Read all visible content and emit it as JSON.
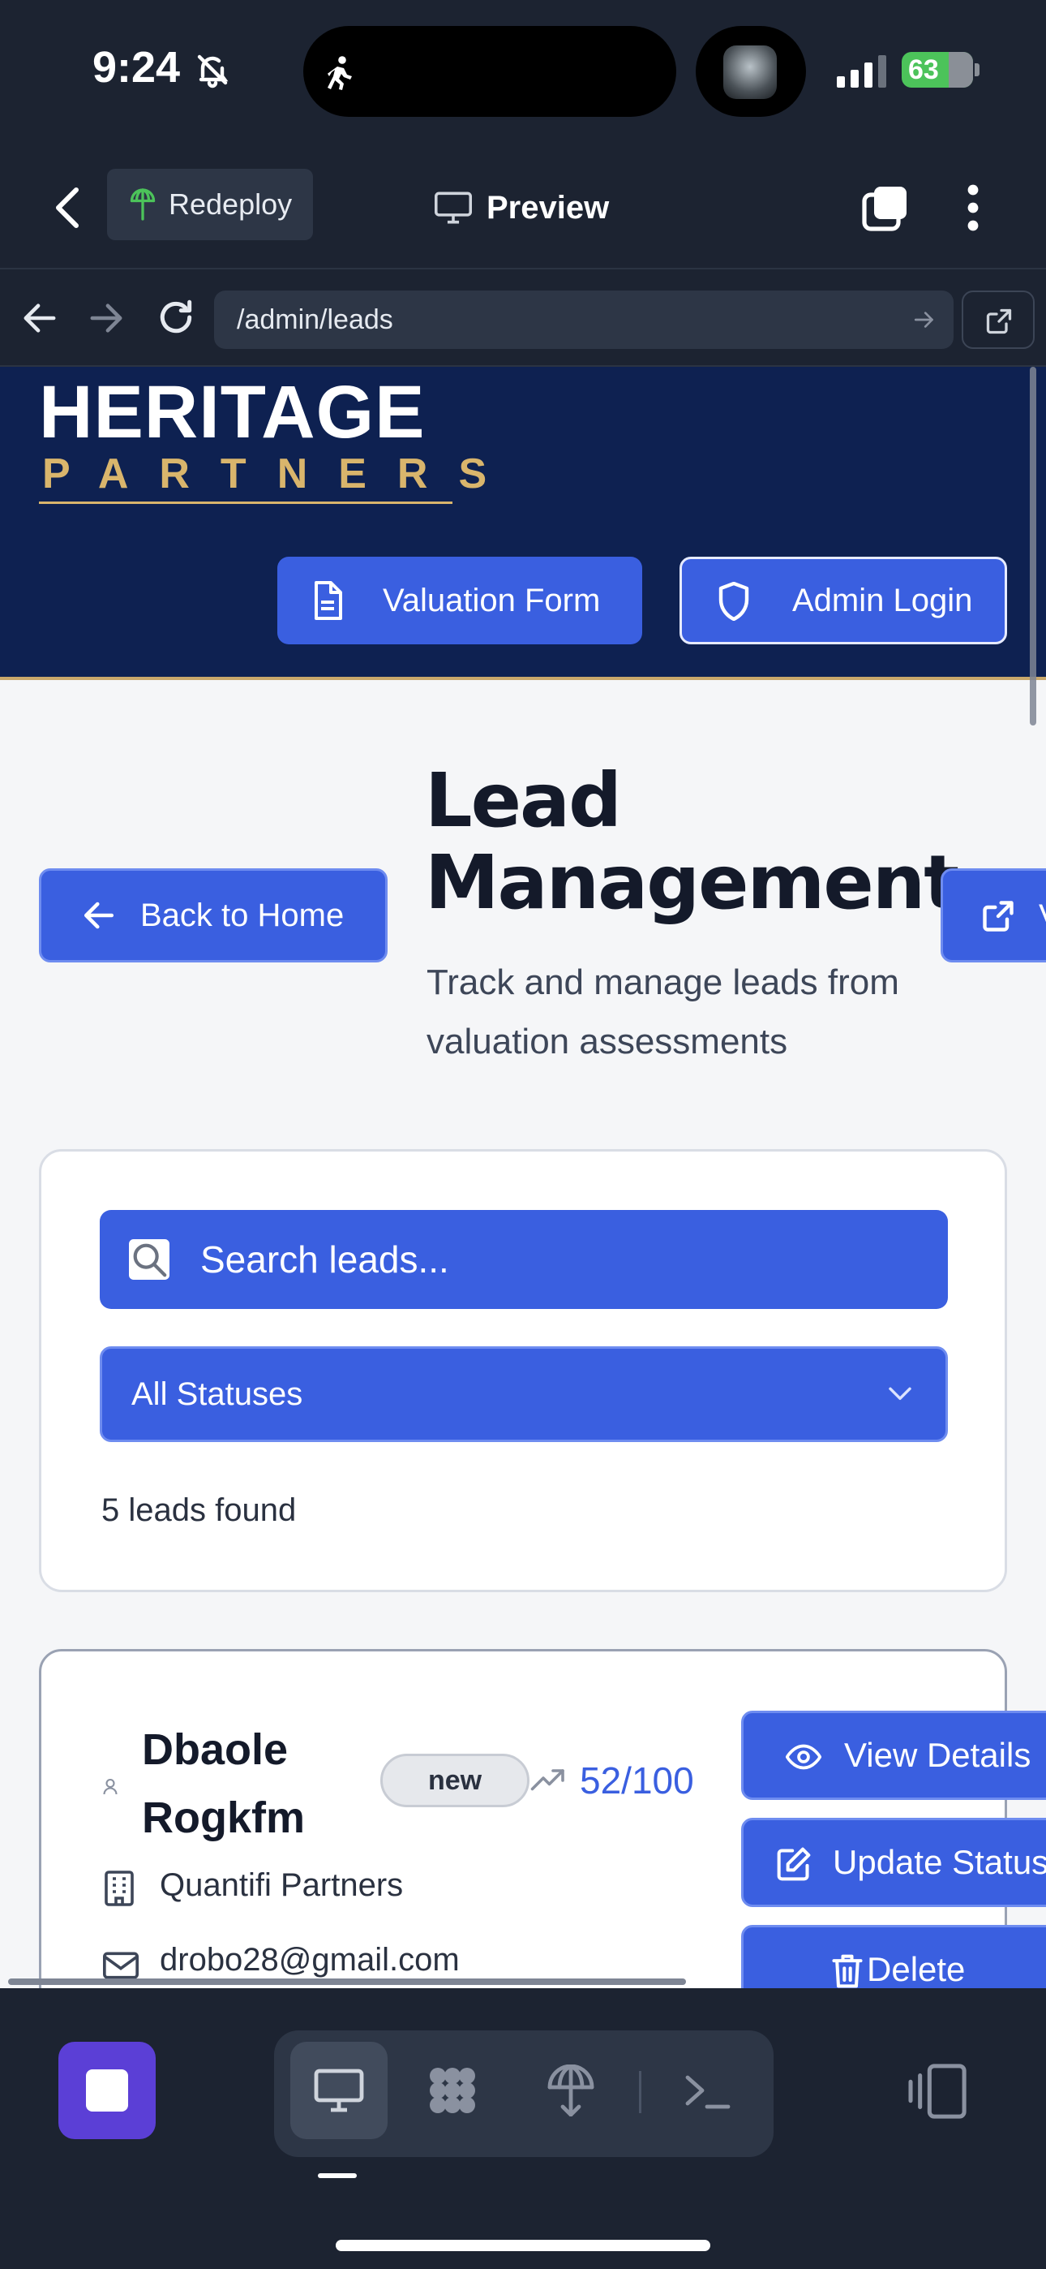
{
  "status_bar": {
    "time": "9:24",
    "battery": "63"
  },
  "toolbar": {
    "redeploy_label": "Redeploy",
    "preview_label": "Preview"
  },
  "browser": {
    "url": "/admin/leads"
  },
  "site": {
    "logo_top": "HERITAGE",
    "logo_bottom": "PARTNERS",
    "nav": {
      "valuation_label": "Valuation Form",
      "admin_label": "Admin Login"
    }
  },
  "page": {
    "back_label": "Back to Home",
    "title": "Lead Management",
    "subtitle": "Track and manage leads from valuation assessments",
    "view_label_cut": "V"
  },
  "filters": {
    "search_placeholder": "Search leads...",
    "status_selected": "All Statuses",
    "leads_found": "5 leads found"
  },
  "leads": [
    {
      "name": "Dbaole Rogkfm",
      "status": "new",
      "score": "52/100",
      "company": "Quantifi Partners",
      "email": "drobo28@gmail.com",
      "actions": {
        "view": "View Details",
        "update": "Update Status",
        "delete": "Delete"
      }
    }
  ],
  "colors": {
    "accent": "#3a5fe0",
    "header_bg": "#0e2151",
    "gold": "#d9b56c",
    "app_chrome": "#1c2331",
    "stop_button": "#5b3fd6"
  }
}
